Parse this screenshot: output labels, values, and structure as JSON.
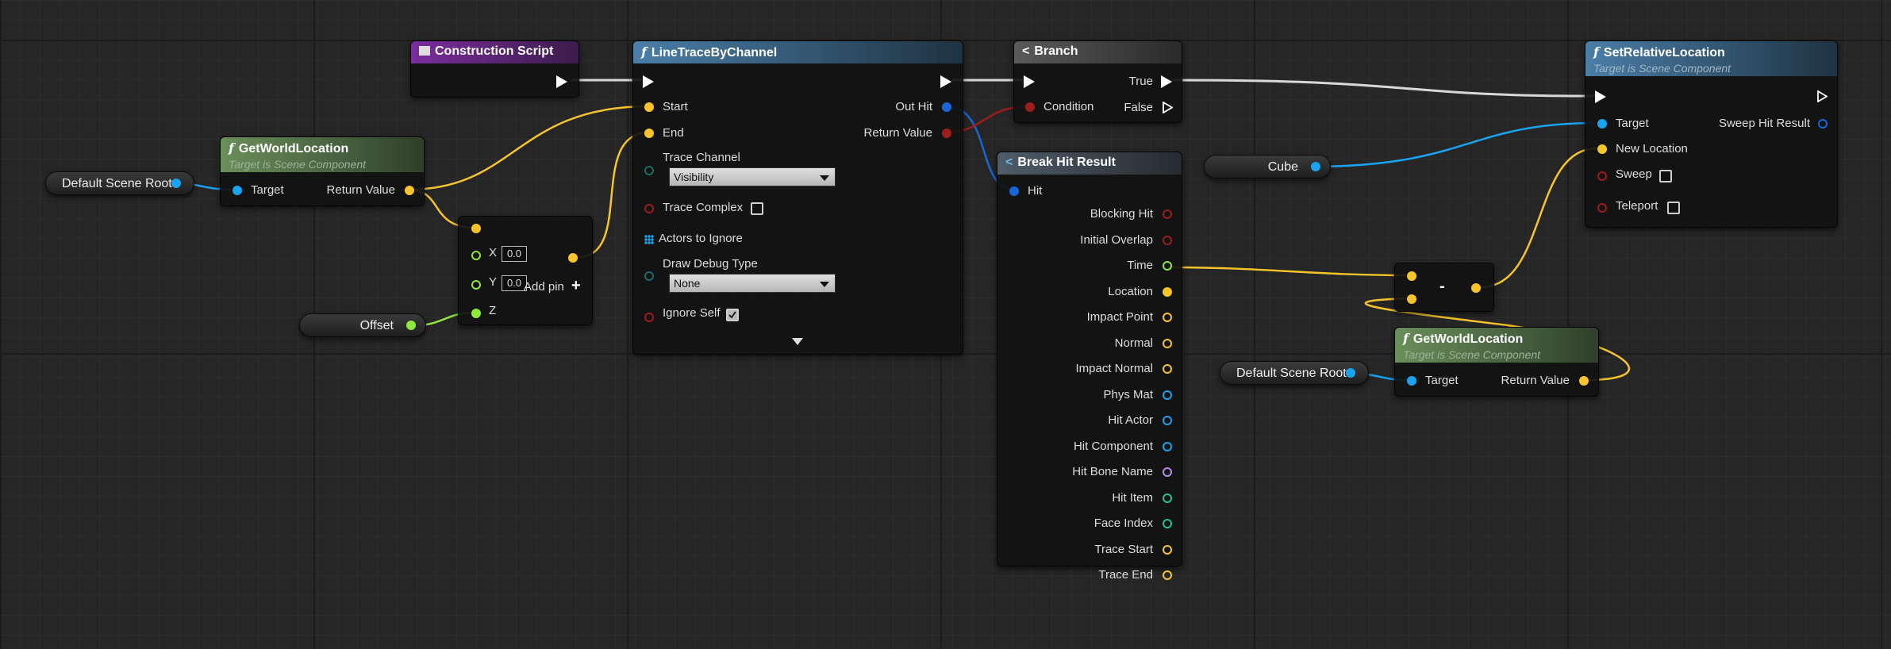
{
  "colors": {
    "vector": "#f7c52b",
    "object": "#1aa3f0",
    "float": "#8fe83c",
    "bool": "#9d1d1d",
    "exec": "#ffffff",
    "byte": "#1d6b66",
    "struct": "#1a66d8",
    "name": "#b78ce8",
    "int": "#2ec08f"
  },
  "nodes": {
    "construction": {
      "title": "Construction Script"
    },
    "trace": {
      "title": "LineTraceByChannel",
      "start": "Start",
      "end": "End",
      "out_hit": "Out Hit",
      "return_value": "Return Value",
      "trace_channel": "Trace Channel",
      "trace_channel_value": "Visibility",
      "trace_complex": "Trace Complex",
      "actors_to_ignore": "Actors to Ignore",
      "draw_debug_type": "Draw Debug Type",
      "draw_debug_value": "None",
      "ignore_self": "Ignore Self"
    },
    "branch": {
      "title": "Branch",
      "true": "True",
      "false": "False",
      "condition": "Condition"
    },
    "setrel": {
      "title": "SetRelativeLocation",
      "subtitle": "Target is Scene Component",
      "target": "Target",
      "sweep_hit_result": "Sweep Hit Result",
      "new_location": "New Location",
      "sweep": "Sweep",
      "teleport": "Teleport"
    },
    "gwl1": {
      "title": "GetWorldLocation",
      "subtitle": "Target is Scene Component",
      "target": "Target",
      "return_value": "Return Value"
    },
    "gwl2": {
      "title": "GetWorldLocation",
      "subtitle": "Target is Scene Component",
      "target": "Target",
      "return_value": "Return Value"
    },
    "dsr1": {
      "label": "Default Scene Root"
    },
    "dsr2": {
      "label": "Default Scene Root"
    },
    "offset": {
      "label": "Offset"
    },
    "cube": {
      "label": "Cube"
    },
    "make": {
      "x": "X",
      "y": "Y",
      "z": "Z",
      "x_value": "0.0",
      "y_value": "0.0",
      "add_pin": "Add pin",
      "plus": "+"
    },
    "subtract": {
      "op": "-"
    },
    "breakhit": {
      "title": "Break Hit Result",
      "hit": "Hit",
      "outputs": [
        "Blocking Hit",
        "Initial Overlap",
        "Time",
        "Location",
        "Impact Point",
        "Normal",
        "Impact Normal",
        "Phys Mat",
        "Hit Actor",
        "Hit Component",
        "Hit Bone Name",
        "Hit Item",
        "Face Index",
        "Trace Start",
        "Trace End"
      ]
    }
  }
}
